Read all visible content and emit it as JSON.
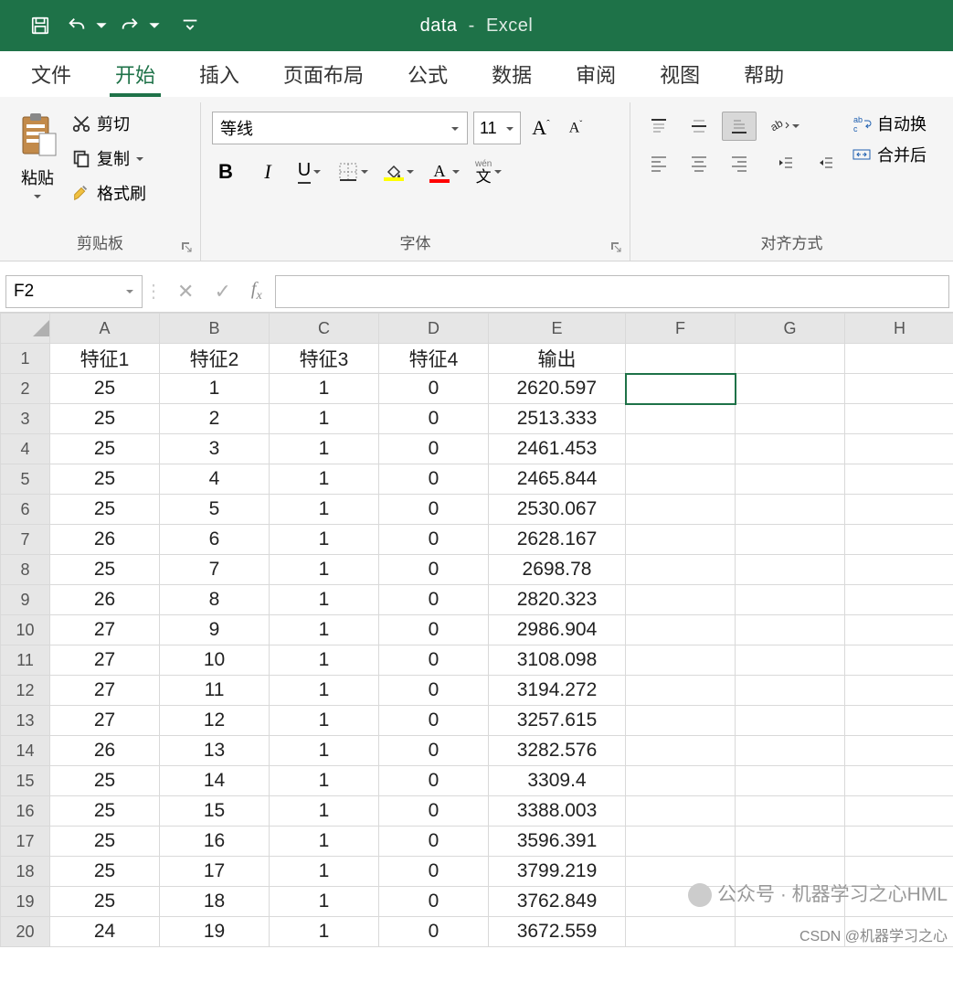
{
  "titlebar": {
    "filename": "data",
    "appname": "Excel"
  },
  "tabs": [
    "文件",
    "开始",
    "插入",
    "页面布局",
    "公式",
    "数据",
    "审阅",
    "视图",
    "帮助"
  ],
  "active_tab": 1,
  "ribbon": {
    "clipboard": {
      "paste": "粘贴",
      "cut": "剪切",
      "copy": "复制",
      "format_painter": "格式刷",
      "label": "剪贴板"
    },
    "font": {
      "name": "等线",
      "size": "11",
      "label": "字体",
      "bold": "B",
      "italic": "I",
      "underline": "U",
      "phonetic": "wén",
      "phonetic2": "文"
    },
    "align": {
      "label": "对齐方式",
      "wrap": "自动换",
      "merge": "合并后"
    }
  },
  "namebox": "F2",
  "columns": [
    "A",
    "B",
    "C",
    "D",
    "E",
    "F",
    "G",
    "H"
  ],
  "headers": [
    "特征1",
    "特征2",
    "特征3",
    "特征4",
    "输出"
  ],
  "rows": [
    [
      "25",
      "1",
      "1",
      "0",
      "2620.597"
    ],
    [
      "25",
      "2",
      "1",
      "0",
      "2513.333"
    ],
    [
      "25",
      "3",
      "1",
      "0",
      "2461.453"
    ],
    [
      "25",
      "4",
      "1",
      "0",
      "2465.844"
    ],
    [
      "25",
      "5",
      "1",
      "0",
      "2530.067"
    ],
    [
      "26",
      "6",
      "1",
      "0",
      "2628.167"
    ],
    [
      "25",
      "7",
      "1",
      "0",
      "2698.78"
    ],
    [
      "26",
      "8",
      "1",
      "0",
      "2820.323"
    ],
    [
      "27",
      "9",
      "1",
      "0",
      "2986.904"
    ],
    [
      "27",
      "10",
      "1",
      "0",
      "3108.098"
    ],
    [
      "27",
      "11",
      "1",
      "0",
      "3194.272"
    ],
    [
      "27",
      "12",
      "1",
      "0",
      "3257.615"
    ],
    [
      "26",
      "13",
      "1",
      "0",
      "3282.576"
    ],
    [
      "25",
      "14",
      "1",
      "0",
      "3309.4"
    ],
    [
      "25",
      "15",
      "1",
      "0",
      "3388.003"
    ],
    [
      "25",
      "16",
      "1",
      "0",
      "3596.391"
    ],
    [
      "25",
      "17",
      "1",
      "0",
      "3799.219"
    ],
    [
      "25",
      "18",
      "1",
      "0",
      "3762.849"
    ],
    [
      "24",
      "19",
      "1",
      "0",
      "3672.559"
    ]
  ],
  "watermark": {
    "line1": "公众号 · 机器学习之心HML",
    "line2": "CSDN @机器学习之心"
  }
}
